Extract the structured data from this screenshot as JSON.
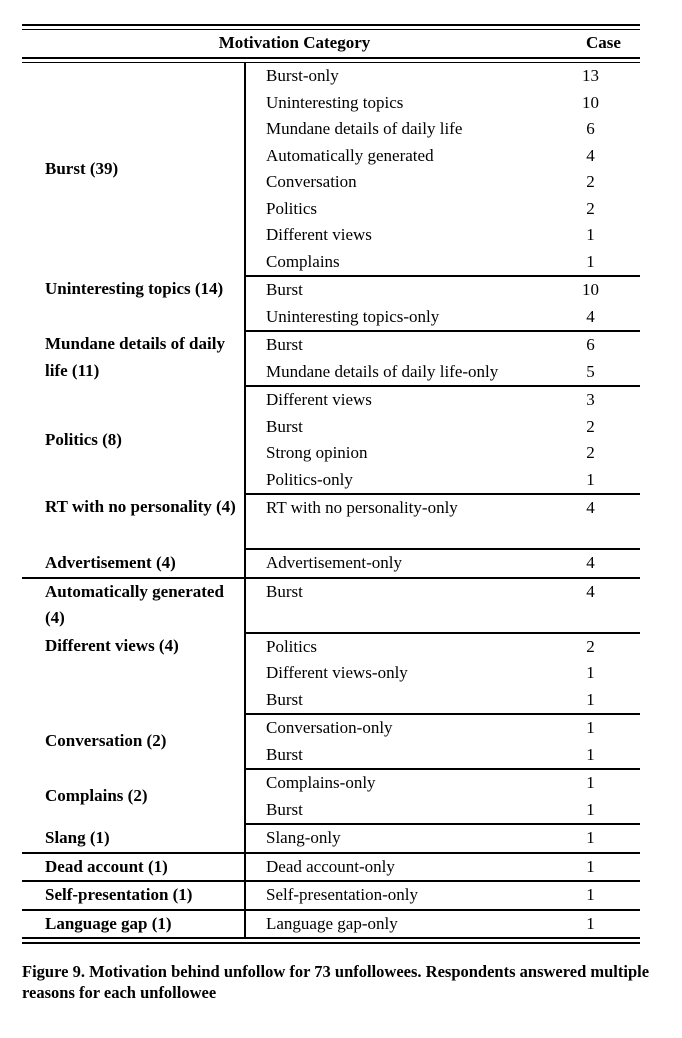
{
  "table": {
    "headers": {
      "category": "Motivation Category",
      "case": "Case"
    },
    "groups": [
      {
        "label": "Burst (39)",
        "label_align": "middle",
        "rows": [
          {
            "reason": "Burst-only",
            "case": "13"
          },
          {
            "reason": "Uninteresting topics",
            "case": "10"
          },
          {
            "reason": "Mundane details of daily life",
            "case": "6"
          },
          {
            "reason": "Automatically generated",
            "case": "4"
          },
          {
            "reason": "Conversation",
            "case": "2"
          },
          {
            "reason": "Politics",
            "case": "2"
          },
          {
            "reason": "Different views",
            "case": "1"
          },
          {
            "reason": "Complains",
            "case": "1"
          }
        ]
      },
      {
        "label": "Uninteresting topics (14)",
        "label_align": "top",
        "rows": [
          {
            "reason": "Burst",
            "case": "10"
          },
          {
            "reason": "Uninteresting topics-only",
            "case": "4"
          }
        ]
      },
      {
        "label": "Mundane details of daily life (11)",
        "label_align": "top",
        "rows": [
          {
            "reason": "Burst",
            "case": "6"
          },
          {
            "reason": "Mundane details of daily life-only",
            "case": "5"
          }
        ]
      },
      {
        "label": "Politics (8)",
        "label_align": "middle",
        "rows": [
          {
            "reason": "Different views",
            "case": "3"
          },
          {
            "reason": "Burst",
            "case": "2"
          },
          {
            "reason": "Strong opinion",
            "case": "2"
          },
          {
            "reason": "Politics-only",
            "case": "1"
          }
        ]
      },
      {
        "label": "RT with no personality (4)",
        "label_align": "top",
        "rows": [
          {
            "reason": "RT with no personality-only",
            "case": "4"
          },
          {
            "reason": "",
            "case": ""
          }
        ]
      },
      {
        "label": "Advertisement  (4)",
        "label_align": "middle",
        "rows": [
          {
            "reason": "Advertisement-only",
            "case": "4"
          }
        ]
      },
      {
        "label": "Automatically generated  (4)",
        "label_align": "top",
        "rows": [
          {
            "reason": "Burst",
            "case": "4"
          },
          {
            "reason": "",
            "case": ""
          }
        ]
      },
      {
        "label": "Different views (4)",
        "label_align": "top",
        "rows": [
          {
            "reason": "Politics",
            "case": "2"
          },
          {
            "reason": "Different views-only",
            "case": "1"
          },
          {
            "reason": "Burst",
            "case": "1"
          }
        ]
      },
      {
        "label": "Conversation (2)",
        "label_align": "middle",
        "rows": [
          {
            "reason": "Conversation-only",
            "case": "1"
          },
          {
            "reason": "Burst",
            "case": "1"
          }
        ]
      },
      {
        "label": "Complains (2)",
        "label_align": "middle",
        "rows": [
          {
            "reason": "Complains-only",
            "case": "1"
          },
          {
            "reason": "Burst",
            "case": "1"
          }
        ]
      },
      {
        "label": "Slang (1)",
        "label_align": "middle",
        "rows": [
          {
            "reason": "Slang-only",
            "case": "1"
          }
        ]
      },
      {
        "label": "Dead account (1)",
        "label_align": "middle",
        "rows": [
          {
            "reason": "Dead account-only",
            "case": "1"
          }
        ]
      },
      {
        "label": "Self-presentation (1)",
        "label_align": "middle",
        "rows": [
          {
            "reason": "Self-presentation-only",
            "case": "1"
          }
        ]
      },
      {
        "label": "Language gap (1)",
        "label_align": "middle",
        "rows": [
          {
            "reason": "Language gap-only",
            "case": "1"
          }
        ]
      }
    ]
  },
  "caption": "Figure 9. Motivation behind unfollow for 73 unfollowees. Respondents answered multiple reasons for each unfollowee",
  "colors": {
    "rule": "#000000",
    "text": "#000000",
    "background": "#ffffff"
  }
}
